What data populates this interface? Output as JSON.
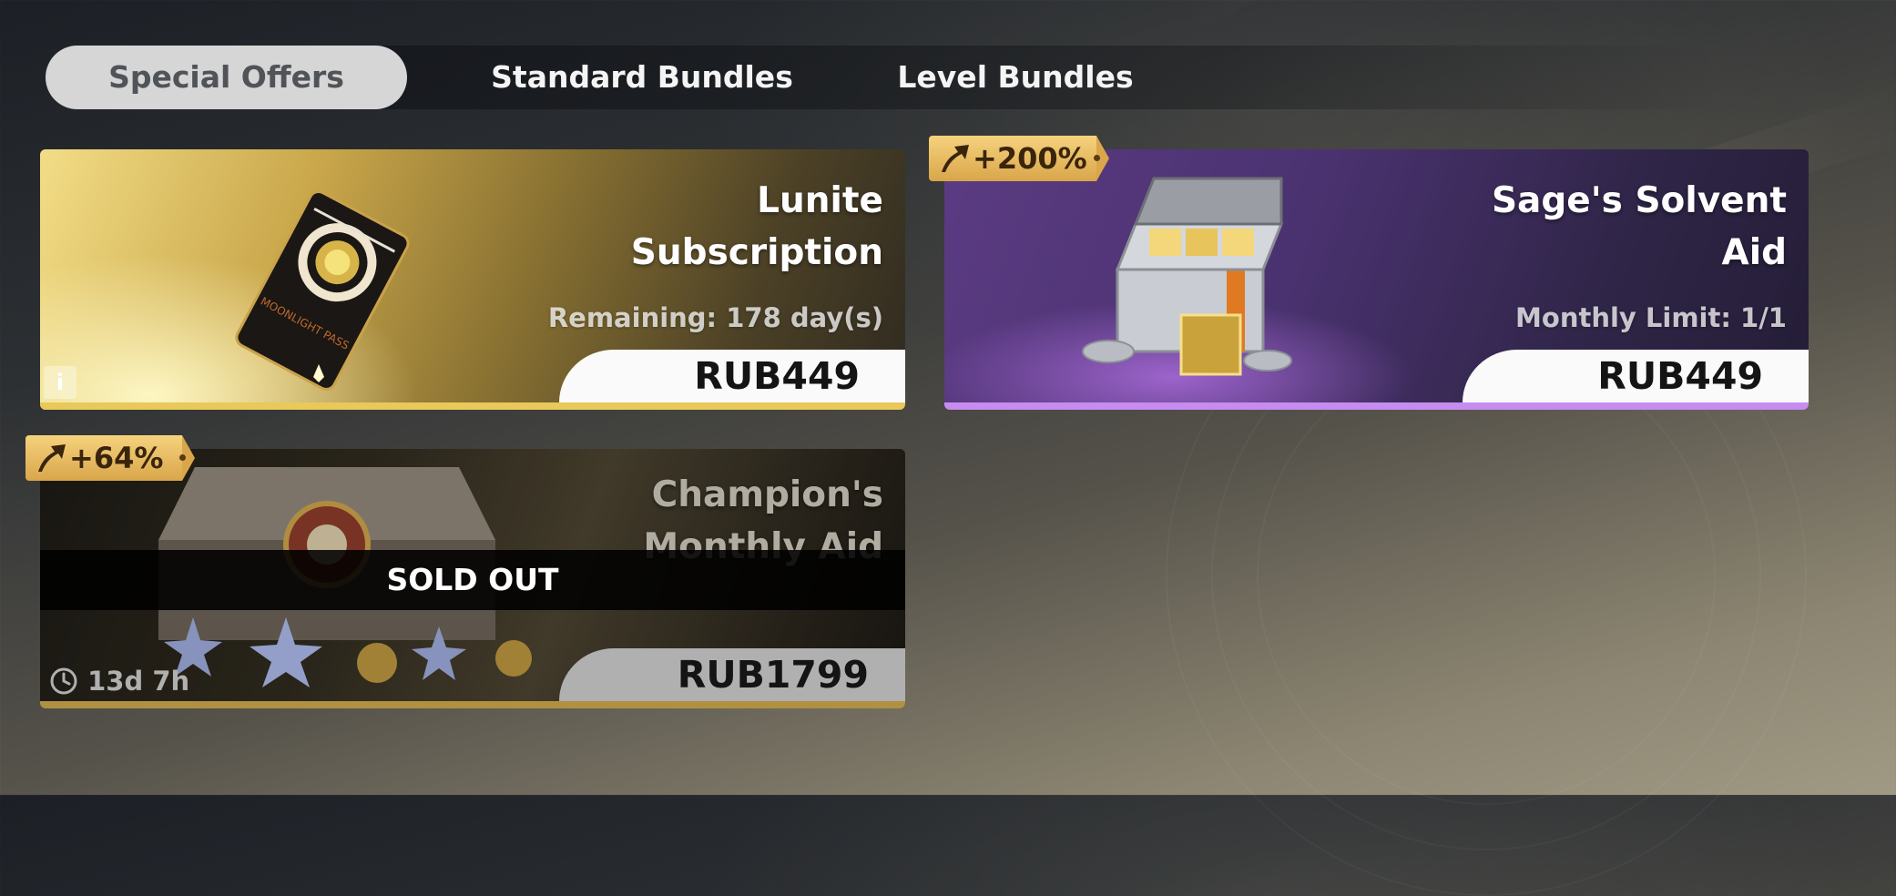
{
  "tabs": [
    {
      "label": "Special Offers",
      "active": true
    },
    {
      "label": "Standard Bundles",
      "active": false
    },
    {
      "label": "Level Bundles",
      "active": false
    }
  ],
  "cards": {
    "lunite": {
      "title_line1": "Lunite",
      "title_line2": "Subscription",
      "subtitle": "Remaining: 178 day(s)",
      "price": "RUB449",
      "info_icon": "i",
      "card_text": "MOONLIGHT PASS",
      "accent": "#e8c95a"
    },
    "sage": {
      "title_line1": "Sage's Solvent",
      "title_line2": "Aid",
      "subtitle": "Monthly Limit: 1/1",
      "price": "RUB449",
      "badge": "+200%",
      "accent": "#c78cf0"
    },
    "champion": {
      "title_line1": "Champion's",
      "title_line2": "Monthly Aid",
      "price": "RUB1799",
      "badge": "+64%",
      "sold_out": "SOLD OUT",
      "timer": "13d 7h",
      "accent": "#c9a64c"
    }
  },
  "icons": [
    "arrow-up-icon",
    "clock-icon",
    "info-icon"
  ]
}
